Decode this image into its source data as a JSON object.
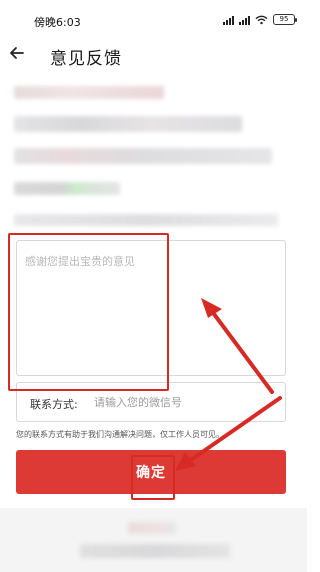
{
  "status_bar": {
    "time": "傍晚6:03",
    "battery": "95"
  },
  "header": {
    "title": "意见反馈"
  },
  "feedback": {
    "placeholder": "感谢您提出宝贵的意见"
  },
  "contact": {
    "label": "联系方式:",
    "placeholder": "请输入您的微信号"
  },
  "note": "您的联系方式有助于我们沟通解决问题，仅工作人员可见。",
  "confirm_button": "确定",
  "colors": {
    "accent": "#dd3a35",
    "annotation": "#d62a25"
  },
  "icons": {
    "back": "back-arrow-icon",
    "signal": "signal-icon",
    "wifi": "wifi-icon",
    "battery": "battery-icon"
  }
}
